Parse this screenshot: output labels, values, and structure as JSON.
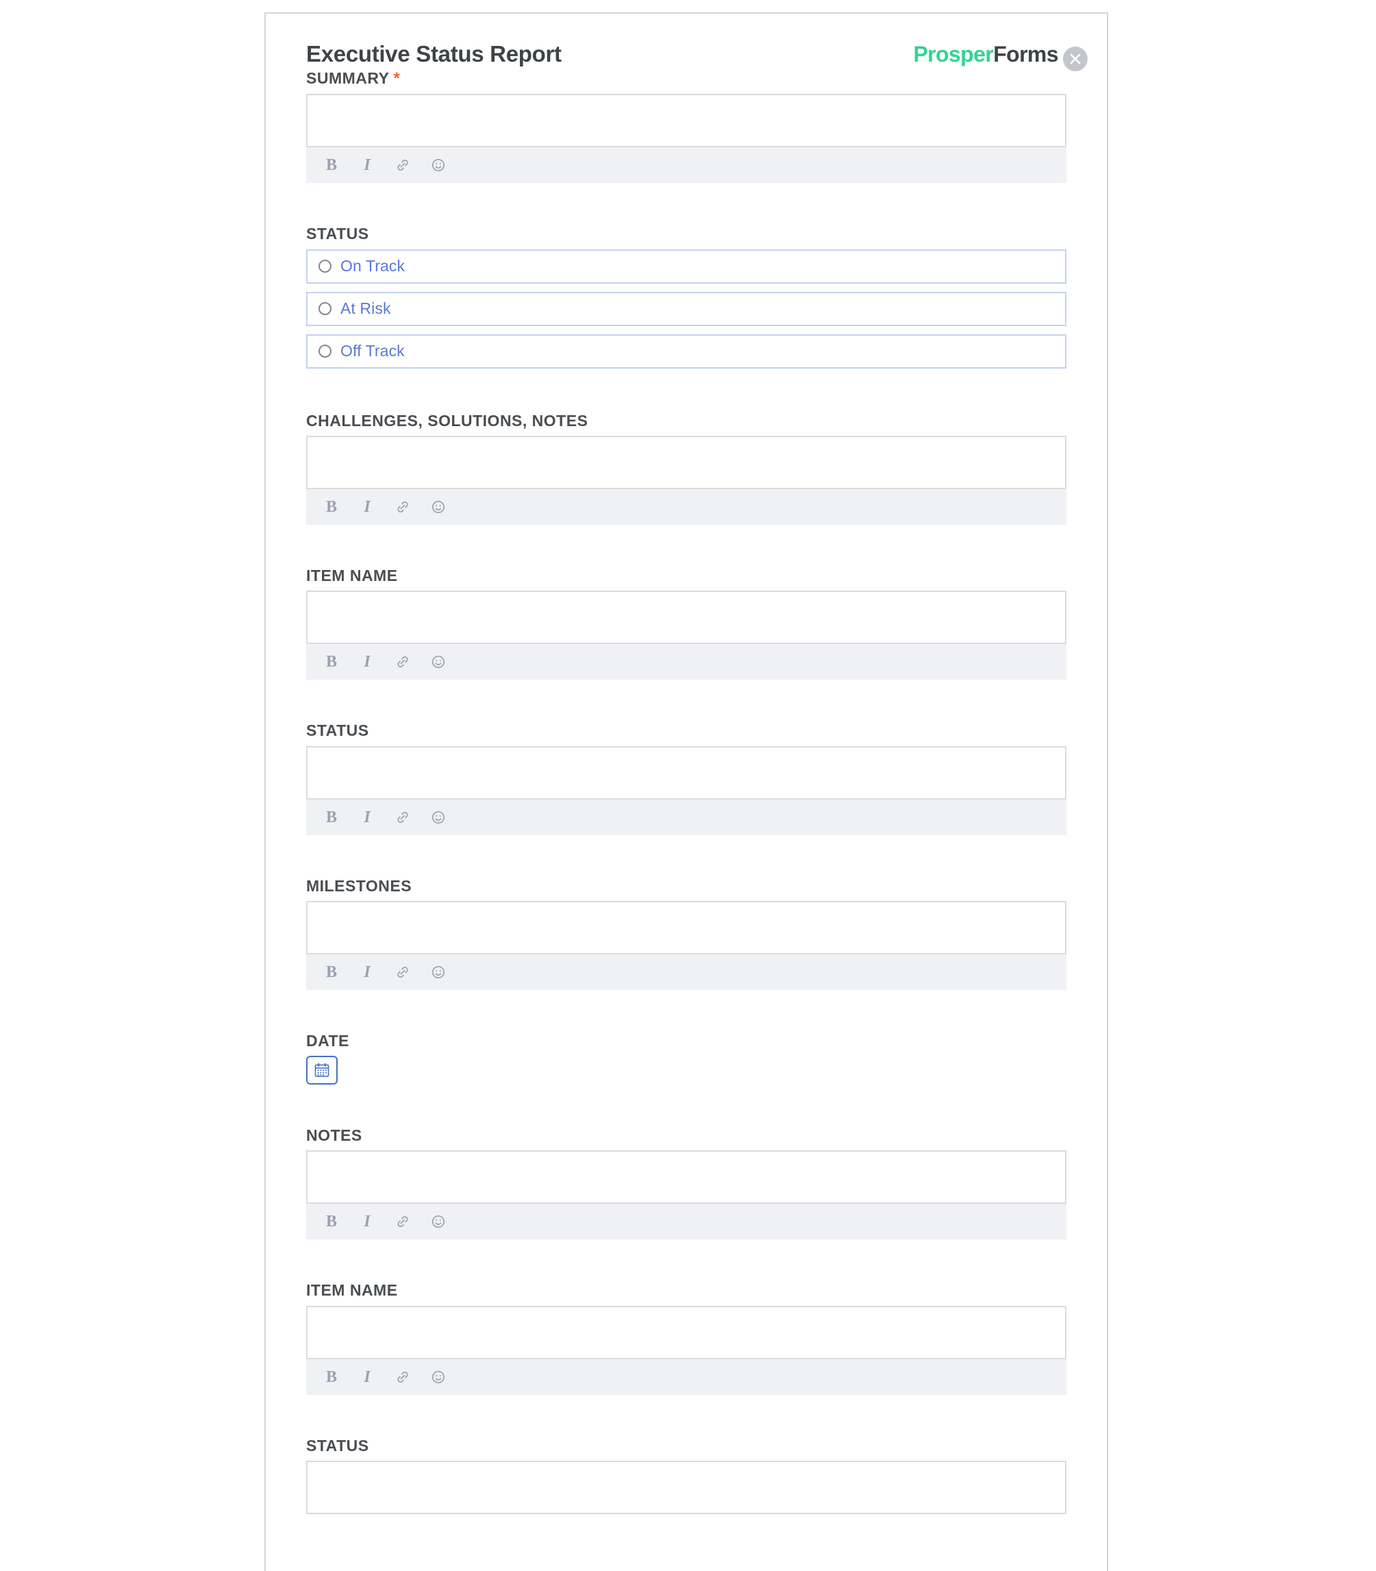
{
  "window": {
    "background": "#ffffff",
    "card_border_color": "#d5d5d5"
  },
  "header": {
    "title": "Executive Status Report",
    "brand_first": "Prosper",
    "brand_second": "Forms",
    "brand_first_color": "#33d396",
    "brand_second_color": "#3f4347",
    "close_icon": "close-icon",
    "close_button_color": "#c3c7cc"
  },
  "editor_toolbar": {
    "bold_label": "B",
    "italic_label": "I",
    "bold_icon": "bold-icon",
    "italic_icon": "italic-icon",
    "link_icon": "link-icon",
    "emoji_icon": "emoji-icon",
    "icon_color": "#9aa1b0",
    "background": "#f0f1f4"
  },
  "fields": {
    "summary": {
      "label": "SUMMARY",
      "required": true,
      "required_marker": "*",
      "required_color": "#f2663c",
      "value": "",
      "placeholder": ""
    },
    "status_radio": {
      "label": "STATUS",
      "options": [
        {
          "label": "On Track",
          "selected": false
        },
        {
          "label": "At Risk",
          "selected": false
        },
        {
          "label": "Off Track",
          "selected": false
        }
      ],
      "option_text_color": "#5b77d6",
      "option_border_color": "#c3d2ef"
    },
    "challenges": {
      "label": "CHALLENGES, SOLUTIONS, NOTES",
      "value": "",
      "placeholder": ""
    },
    "item_name_1": {
      "label": "ITEM NAME",
      "value": "",
      "placeholder": ""
    },
    "status_1": {
      "label": "STATUS",
      "value": "",
      "placeholder": ""
    },
    "milestones": {
      "label": "MILESTONES",
      "value": "",
      "placeholder": ""
    },
    "date": {
      "label": "DATE",
      "icon": "calendar-icon",
      "value": "",
      "border_color": "#4472c4"
    },
    "notes": {
      "label": "NOTES",
      "value": "",
      "placeholder": ""
    },
    "item_name_2": {
      "label": "ITEM NAME",
      "value": "",
      "placeholder": ""
    },
    "status_2": {
      "label": "STATUS",
      "value": "",
      "placeholder": ""
    }
  }
}
